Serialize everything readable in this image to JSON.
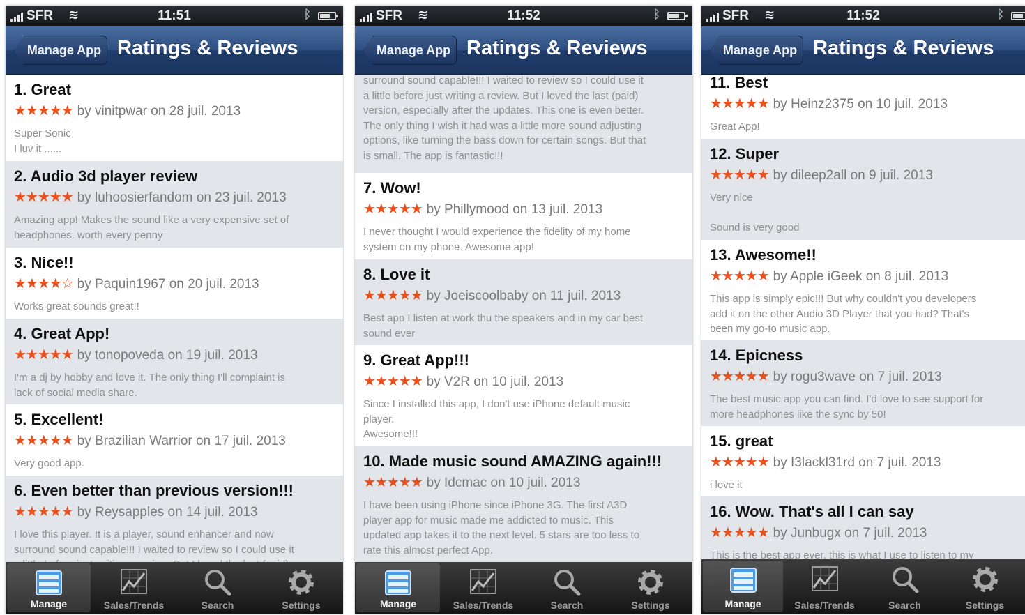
{
  "colors": {
    "star": "#e8501e",
    "navbar": "#2f4f82",
    "rowAlt": "#e2e6eb"
  },
  "screens": [
    {
      "status": {
        "carrier": "SFR",
        "time": "11:51"
      },
      "nav": {
        "back_label": "Manage App",
        "title": "Ratings & Reviews"
      },
      "reviews": [
        {
          "title": "1. Great",
          "stars": "★★★★★",
          "by": "by vinitpwar on 28 juil. 2013",
          "body": "Super Sonic\nI luv it ......"
        },
        {
          "title": "2. Audio 3d player review",
          "stars": "★★★★★",
          "by": "by luhoosierfandom on 23 juil. 2013",
          "body": "Amazing app! Makes the sound like a very expensive set of\nheadphones. worth every penny"
        },
        {
          "title": "3. Nice!!",
          "stars": "★★★★☆",
          "by": "by Paquin1967 on 20 juil. 2013",
          "body": "Works great sounds great!!"
        },
        {
          "title": "4. Great App!",
          "stars": "★★★★★",
          "by": "by tonopoveda on 19 juil. 2013",
          "body": "I'm a dj by hobby and love it. The only thing I'll complaint is\nlack of social media share."
        },
        {
          "title": "5. Excellent!",
          "stars": "★★★★★",
          "by": "by Brazilian Warrior on 17 juil. 2013",
          "body": "Very good app."
        },
        {
          "title": "6. Even better than previous version!!!",
          "stars": "★★★★★",
          "by": "by Reysapples on 14 juil. 2013",
          "body": "I love this player. It is a player, sound enhancer and now\nsurround sound capable!!! I waited to review so I could use it\na little before just writing a review. But I loved the last (paid)"
        }
      ],
      "tabs": [
        {
          "label": "Manage",
          "icon": "manage-icon"
        },
        {
          "label": "Sales/Trends",
          "icon": "chart-icon"
        },
        {
          "label": "Search",
          "icon": "search-icon"
        },
        {
          "label": "Settings",
          "icon": "gear-icon"
        }
      ]
    },
    {
      "status": {
        "carrier": "SFR",
        "time": "11:52"
      },
      "nav": {
        "back_label": "Manage App",
        "title": "Ratings & Reviews"
      },
      "continuation": "surround sound capable!!! I waited to review so I could use it\na little before just writing a review. But I loved the last (paid)\nversion, especially after the updates. This one is even better.\nThe only thing I wish it had was a little more sound adjusting\noptions, like turning the bass down for certain songs. But that\nis small. The app is fantastic!!!",
      "reviews": [
        {
          "title": "7. Wow!",
          "stars": "★★★★★",
          "by": "by Phillymood on 13 juil. 2013",
          "body": "I never thought I would experience the fidelity of my home\nsystem on my phone. Awesome app!"
        },
        {
          "title": "8. Love it",
          "stars": "★★★★★",
          "by": "by Joeiscoolbaby on 11 juil. 2013",
          "body": "Best app I listen at work thu the speakers and in my car best\nsound ever"
        },
        {
          "title": "9. Great App!!!",
          "stars": "★★★★★",
          "by": "by V2R on 10 juil. 2013",
          "body": "Since I installed this app, I don't use iPhone default music\nplayer.\nAwesome!!!"
        },
        {
          "title": "10. Made music sound AMAZING again!!!",
          "stars": "★★★★★",
          "by": "by Idcmac on 10 juil. 2013",
          "body": "I have been using iPhone since iPhone 3G. The first A3D\nplayer app for music made me addicted to music. This\nupdated app takes it to the next level. 5 stars are  too less to\nrate this almost perfect App."
        }
      ],
      "tabs": [
        {
          "label": "Manage",
          "icon": "manage-icon"
        },
        {
          "label": "Sales/Trends",
          "icon": "chart-icon"
        },
        {
          "label": "Search",
          "icon": "search-icon"
        },
        {
          "label": "Settings",
          "icon": "gear-icon"
        }
      ]
    },
    {
      "status": {
        "carrier": "SFR",
        "time": "11:52"
      },
      "nav": {
        "back_label": "Manage App",
        "title": "Ratings & Reviews"
      },
      "reviews": [
        {
          "title": "11. Best",
          "stars": "★★★★★",
          "by": "by Heinz2375 on 10 juil. 2013",
          "body": "Great App!"
        },
        {
          "title": "12. Super",
          "stars": "★★★★★",
          "by": "by dileep2all on 9 juil. 2013",
          "body": "Very nice\n\nSound is very good"
        },
        {
          "title": "13. Awesome!!",
          "stars": "★★★★★",
          "by": "by Apple iGeek on 8 juil. 2013",
          "body": "This app is simply epic!!! But why couldn't you developers\nadd it on the other Audio 3D Player that you had? That's\nbeen my go-to music app."
        },
        {
          "title": "14. Epicness",
          "stars": "★★★★★",
          "by": "by rogu3wave on 7 juil. 2013",
          "body": "The best music app you can find. I'd love to see support for\nmore headphones like the sync by 50!"
        },
        {
          "title": "15. great",
          "stars": "★★★★★",
          "by": "by I3lackl31rd on 7 juil. 2013",
          "body": "i love it"
        },
        {
          "title": "16. Wow. That's all I can say",
          "stars": "★★★★★",
          "by": "by Junbugx on 7 juil. 2013",
          "body": "This is the best app ever, this is what I use to listen to my"
        }
      ],
      "tabs": [
        {
          "label": "Manage",
          "icon": "manage-icon"
        },
        {
          "label": "Sales/Trends",
          "icon": "chart-icon"
        },
        {
          "label": "Search",
          "icon": "search-icon"
        },
        {
          "label": "Settings",
          "icon": "gear-icon"
        }
      ]
    }
  ]
}
